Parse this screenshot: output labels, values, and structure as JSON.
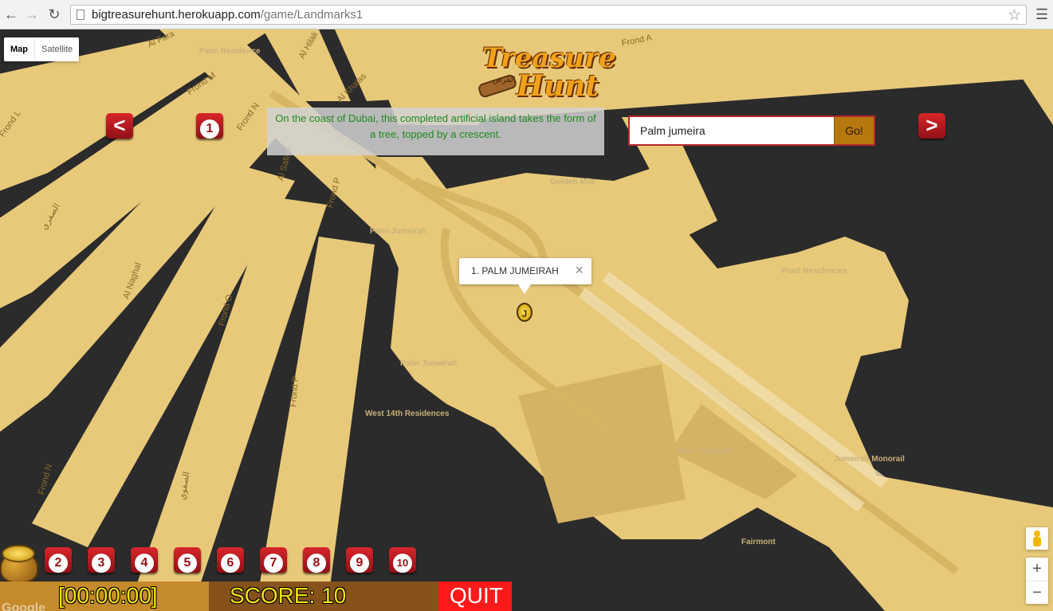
{
  "browser": {
    "url_host": "bigtreasurehunt.herokuapp.com",
    "url_path": "/game/Landmarks1",
    "back_icon": "arrow-left-icon",
    "forward_icon": "arrow-right-icon",
    "reload_icon": "reload-icon",
    "star_icon": "star-icon",
    "menu_icon": "hamburger-menu-icon"
  },
  "map_type": {
    "map_label": "Map",
    "satellite_label": "Satellite",
    "selected": "Map"
  },
  "logo": {
    "line1": "Treasure",
    "line2": "Hunt",
    "subtitle": "القرص"
  },
  "nav": {
    "prev_label": "<",
    "next_label": ">",
    "current_marker": "1"
  },
  "clue": {
    "text": "On the coast of Dubai, this completed artificial island takes the form of a tree, topped by a crescent."
  },
  "search": {
    "value": "Palm jumeira",
    "go_label": "Go!"
  },
  "info_window": {
    "title": "1. PALM JUMEIRAH",
    "close_label": "×",
    "marker_label": "J"
  },
  "map_labels": {
    "roads": [
      "Al Fara",
      "Al Hilali",
      "Frond M",
      "Frond N",
      "Al Khalas",
      "Frond A",
      "Frond L",
      "Al Safaai",
      "Frond P",
      "الصفري",
      "Al Naghal",
      "Frond O",
      "Frond P",
      "Frond N",
      "الصفوي"
    ],
    "places": [
      "Palm Residence",
      "Palm Jumeirah",
      "Golden Mile",
      "Palm Jumeirah",
      "West 14th Residences",
      "Palm Jumeirah",
      "Jumeirah Monorail",
      "Fairmont",
      "Pearl Residences"
    ]
  },
  "level_tiles": [
    "2",
    "3",
    "4",
    "5",
    "6",
    "7",
    "8",
    "9",
    "10"
  ],
  "footer": {
    "timer": "[00:00:00]",
    "score": "SCORE: 10",
    "quit_label": "QUIT"
  },
  "google_text": "Google",
  "zoom": {
    "in_label": "+",
    "out_label": "−"
  },
  "colors": {
    "land": "#e8c97a",
    "land_dark": "#d9b568",
    "water": "#2b2b2b",
    "accent_red": "#c41a20",
    "clue_text": "#1d8a1d"
  }
}
